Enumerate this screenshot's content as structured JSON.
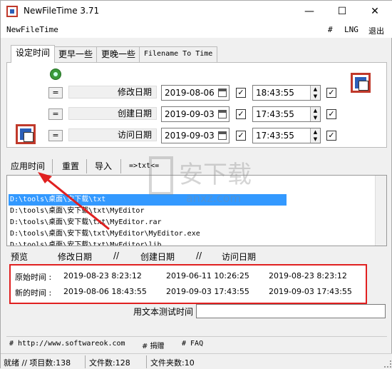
{
  "window": {
    "title": "NewFileTime 3.71",
    "minimize": "—",
    "maximize": "☐",
    "close": "✕"
  },
  "menu": {
    "app": "NewFileTime",
    "hash": "#",
    "lng": "LNG",
    "exit": "退出"
  },
  "tabs": [
    "设定时间",
    "更早一些",
    "更晚一些",
    "Filename To Time"
  ],
  "rows": [
    {
      "eq": "=",
      "label": "修改日期",
      "date": "2019-08-06",
      "time": "18:43:55",
      "date_checked": true,
      "time_checked": true
    },
    {
      "eq": "=",
      "label": "创建日期",
      "date": "2019-09-03",
      "time": "17:43:55",
      "date_checked": true,
      "time_checked": true
    },
    {
      "eq": "=",
      "label": "访问日期",
      "date": "2019-09-03",
      "time": "17:43:55",
      "date_checked": true,
      "time_checked": true
    }
  ],
  "toolbar": {
    "apply": "应用时间",
    "reset": "重置",
    "import": "导入",
    "txt": "=>txt<="
  },
  "files": [
    "D:\\tools\\桌面\\安下载\\txt",
    "D:\\tools\\桌面\\安下载\\txt\\MyEditor",
    "D:\\tools\\桌面\\安下载\\txt\\MyEditor.rar",
    "D:\\tools\\桌面\\安下载\\txt\\MyEditor\\MyEditor.exe",
    "D:\\tools\\桌面\\安下载\\txt\\MyEditor\\lib"
  ],
  "preview_header": {
    "preview": "预览",
    "modify": "修改日期",
    "sep1": "//",
    "create": "创建日期",
    "sep2": "//",
    "access": "访问日期"
  },
  "time_panel": {
    "original_label": "原始时间 :",
    "original": [
      "2019-08-23  8:23:12",
      "2019-06-11  10:26:25",
      "2019-08-23  8:23:12"
    ],
    "new_label": "新的时间 :",
    "new": [
      "2019-08-06  18:43:55",
      "2019-09-03  17:43:55",
      "2019-09-03  17:43:55"
    ]
  },
  "test": {
    "label": "用文本测试时间",
    "value": ""
  },
  "links": {
    "website": "# http://www.softwareok.com",
    "donate": "# 捐赠",
    "faq": "# FAQ"
  },
  "status": {
    "ready": "就绪 // 项目数:138",
    "files": "文件数:128",
    "folders": "文件夹数:10"
  },
  "colors": {
    "highlight": "#e02020",
    "selection": "#3399ff"
  }
}
